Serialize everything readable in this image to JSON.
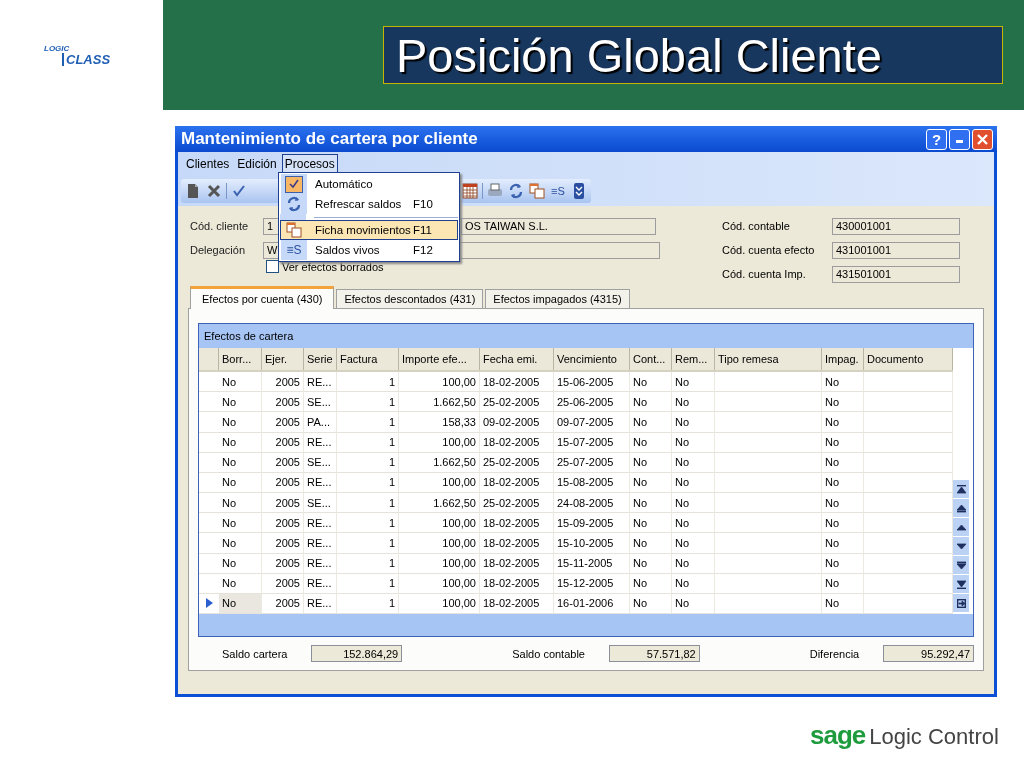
{
  "slide": {
    "logo": {
      "top": "LOGIC",
      "bottom": "CLASS"
    },
    "title": "Posición Global Cliente",
    "footer_logo": {
      "brand": "sage",
      "product": "Logic Control"
    }
  },
  "window": {
    "title": "Mantenimiento de cartera por cliente",
    "help": "?"
  },
  "menubar": [
    {
      "label": "Clientes",
      "open": false
    },
    {
      "label": "Edición",
      "open": false
    },
    {
      "label": "Procesos",
      "open": true
    }
  ],
  "menu": [
    {
      "kind": "check",
      "label": "Automático",
      "checked": true,
      "selected": false
    },
    {
      "kind": "refresh",
      "label": "Refrescar saldos",
      "shortcut": "F10",
      "selected": false
    },
    {
      "kind": "separator"
    },
    {
      "kind": "copy",
      "label": "Ficha movimientos",
      "shortcut": "F11",
      "selected": true
    },
    {
      "kind": "text",
      "icon_text": "≡S",
      "label": "Saldos vivos",
      "shortcut": "F12",
      "selected": false
    }
  ],
  "toolbar": {
    "text_button": "≡S"
  },
  "form": {
    "client_label": "Cód. cliente",
    "client_code": "1",
    "client_name": "OS TAIWAN S.L.",
    "delegation_label": "Delegación",
    "delegation": "W",
    "show_deleted": {
      "label": "Ver efectos borrados",
      "checked": false
    },
    "accounts": [
      {
        "label": "Cód. contable",
        "value": "430001001"
      },
      {
        "label": "Cód. cuenta efecto",
        "value": "431001001"
      },
      {
        "label": "Cód. cuenta Imp.",
        "value": "431501001"
      }
    ]
  },
  "tabs": [
    {
      "label": "Efectos por cuenta (430)",
      "selected": true
    },
    {
      "label": "Efectos descontados (431)",
      "selected": false
    },
    {
      "label": "Efectos impagados (4315)",
      "selected": false
    }
  ],
  "grid": {
    "title": "Efectos de cartera",
    "columns": [
      "Borr...",
      "Ejer.",
      "Serie",
      "Factura",
      "Importe efe...",
      "Fecha emi.",
      "Vencimiento",
      "Cont...",
      "Rem...",
      "Tipo remesa",
      "Impag.",
      "Documento"
    ],
    "rows": [
      {
        "selected": false,
        "cells": [
          "No",
          "2005",
          "RE...",
          "1",
          "100,00",
          "18-02-2005",
          "15-06-2005",
          "No",
          "No",
          null,
          "No",
          null
        ]
      },
      {
        "selected": false,
        "cells": [
          "No",
          "2005",
          "SE...",
          "1",
          "1.662,50",
          "25-02-2005",
          "25-06-2005",
          "No",
          "No",
          null,
          "No",
          null
        ]
      },
      {
        "selected": false,
        "cells": [
          "No",
          "2005",
          "PA...",
          "1",
          "158,33",
          "09-02-2005",
          "09-07-2005",
          "No",
          "No",
          null,
          "No",
          null
        ]
      },
      {
        "selected": false,
        "cells": [
          "No",
          "2005",
          "RE...",
          "1",
          "100,00",
          "18-02-2005",
          "15-07-2005",
          "No",
          "No",
          null,
          "No",
          null
        ]
      },
      {
        "selected": false,
        "cells": [
          "No",
          "2005",
          "SE...",
          "1",
          "1.662,50",
          "25-02-2005",
          "25-07-2005",
          "No",
          "No",
          null,
          "No",
          null
        ]
      },
      {
        "selected": false,
        "cells": [
          "No",
          "2005",
          "RE...",
          "1",
          "100,00",
          "18-02-2005",
          "15-08-2005",
          "No",
          "No",
          null,
          "No",
          null
        ]
      },
      {
        "selected": false,
        "cells": [
          "No",
          "2005",
          "SE...",
          "1",
          "1.662,50",
          "25-02-2005",
          "24-08-2005",
          "No",
          "No",
          null,
          "No",
          null
        ]
      },
      {
        "selected": false,
        "cells": [
          "No",
          "2005",
          "RE...",
          "1",
          "100,00",
          "18-02-2005",
          "15-09-2005",
          "No",
          "No",
          null,
          "No",
          null
        ]
      },
      {
        "selected": false,
        "cells": [
          "No",
          "2005",
          "RE...",
          "1",
          "100,00",
          "18-02-2005",
          "15-10-2005",
          "No",
          "No",
          null,
          "No",
          null
        ]
      },
      {
        "selected": false,
        "cells": [
          "No",
          "2005",
          "RE...",
          "1",
          "100,00",
          "18-02-2005",
          "15-11-2005",
          "No",
          "No",
          null,
          "No",
          null
        ]
      },
      {
        "selected": false,
        "cells": [
          "No",
          "2005",
          "RE...",
          "1",
          "100,00",
          "18-02-2005",
          "15-12-2005",
          "No",
          "No",
          null,
          "No",
          null
        ]
      },
      {
        "selected": true,
        "cells": [
          "No",
          "2005",
          "RE...",
          "1",
          "100,00",
          "18-02-2005",
          "16-01-2006",
          "No",
          "No",
          null,
          "No",
          null
        ]
      }
    ]
  },
  "totals": [
    {
      "label": "Saldo cartera",
      "value": "152.864,29"
    },
    {
      "label": "Saldo contable",
      "value": "57.571,82"
    },
    {
      "label": "Diferencia",
      "value": "95.292,47"
    }
  ]
}
